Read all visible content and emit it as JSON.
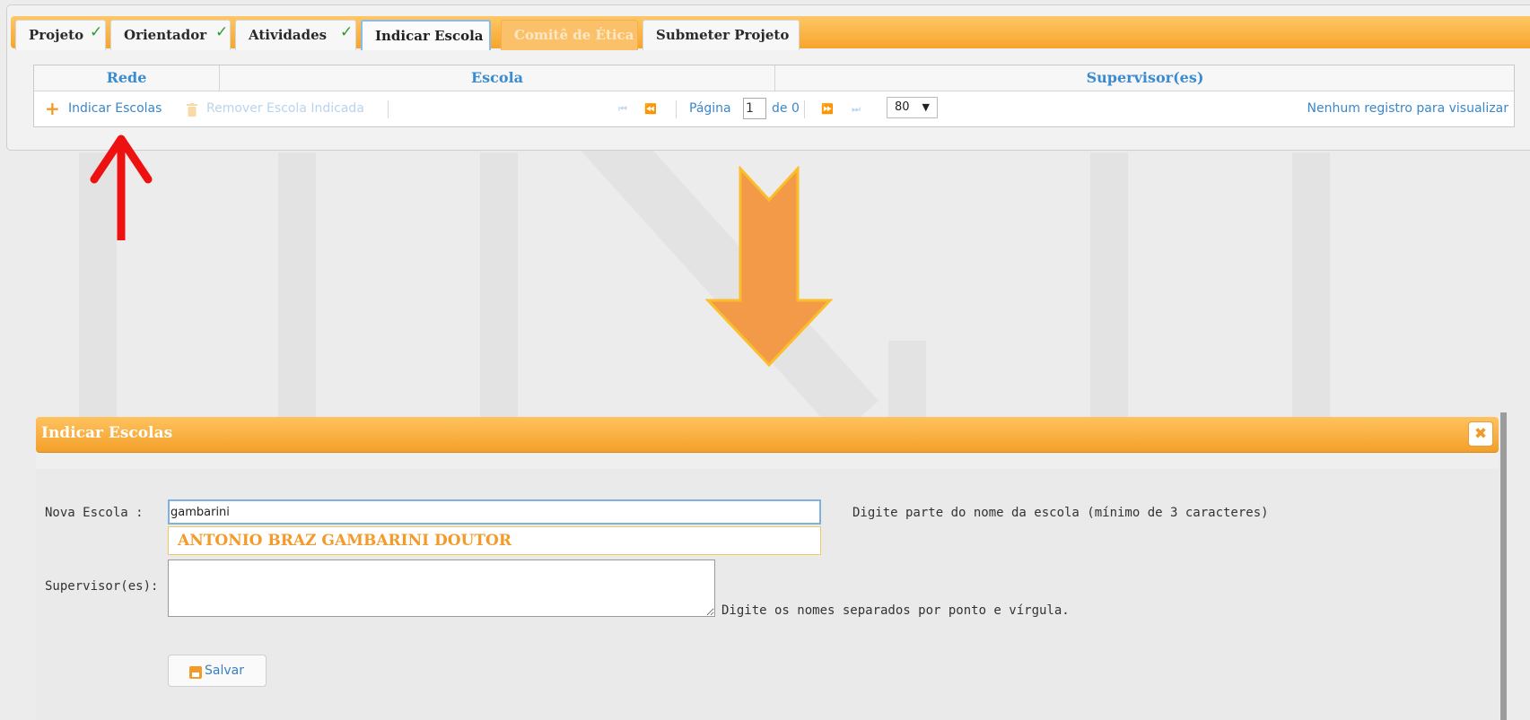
{
  "tabs": [
    {
      "label": "Projeto",
      "checked": true,
      "state": "normal"
    },
    {
      "label": "Orientador",
      "checked": true,
      "state": "normal"
    },
    {
      "label": "Atividades",
      "checked": true,
      "state": "normal"
    },
    {
      "label": "Indicar Escola",
      "checked": false,
      "state": "active"
    },
    {
      "label": "Comitê de Ética",
      "checked": false,
      "state": "disabled"
    },
    {
      "label": "Submeter Projeto",
      "checked": false,
      "state": "normal"
    }
  ],
  "check_glyph": "✓",
  "grid": {
    "columns": [
      "Rede",
      "Escola",
      "Supervisor(es)"
    ],
    "toolbar": {
      "add_icon": "+",
      "add_label": "Indicar Escolas",
      "remove_icon": "trash-icon",
      "remove_label": "Remover Escola Indicada",
      "first_icon": "⏮",
      "prev_icon": "⏪",
      "page_label": "Página",
      "page_value": "1",
      "of_label": "de 0",
      "next_icon": "⏩",
      "last_icon": "⏭",
      "page_size": "80",
      "empty_message": "Nenhum registro para visualizar"
    }
  },
  "dialog": {
    "title": "Indicar Escolas",
    "close_icon": "✖",
    "nova_escola_label": "Nova Escola :",
    "nova_escola_value": "gambarini",
    "nova_escola_hint": "Digite parte do nome da escola (mínimo de 3 caracteres)",
    "suggestion": "ANTONIO BRAZ GAMBARINI DOUTOR",
    "supervisores_label": "Supervisor(es):",
    "supervisores_value": "",
    "supervisores_hint": "Digite os nomes separados por ponto e vírgula.",
    "save_label": "Salvar"
  },
  "colors": {
    "accent_orange": "#f6a52c",
    "link_blue": "#3a87c9",
    "annotation_red": "#ee1111",
    "annotation_arrow_orange": "#f39a48"
  }
}
